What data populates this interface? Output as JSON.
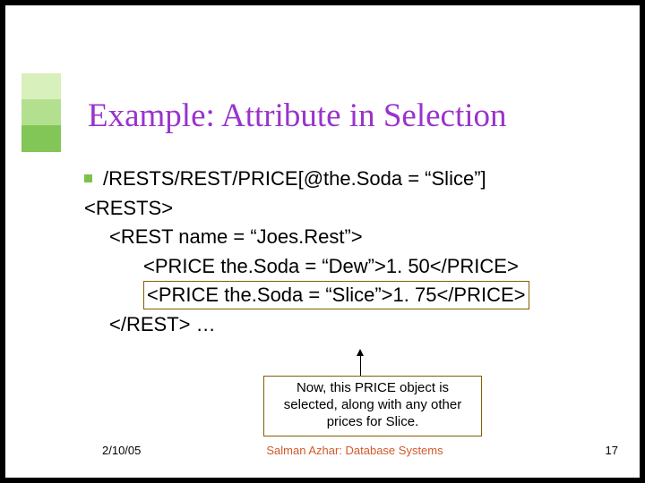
{
  "title": "Example: Attribute in Selection",
  "bullet": "/RESTS/REST/PRICE[@the.Soda = “Slice”]",
  "code": {
    "l1": "<RESTS>",
    "l2": "<REST name = “Joes.Rest”>",
    "l3": "<PRICE the.Soda = “Dew”>1. 50</PRICE>",
    "l4": "<PRICE the.Soda = “Slice”>1. 75</PRICE>",
    "l5": "</REST> …"
  },
  "callout": "Now, this PRICE object is selected, along with any other prices for Slice.",
  "footer": {
    "date": "2/10/05",
    "author": "Salman Azhar: Database Systems",
    "pageno": "17"
  }
}
